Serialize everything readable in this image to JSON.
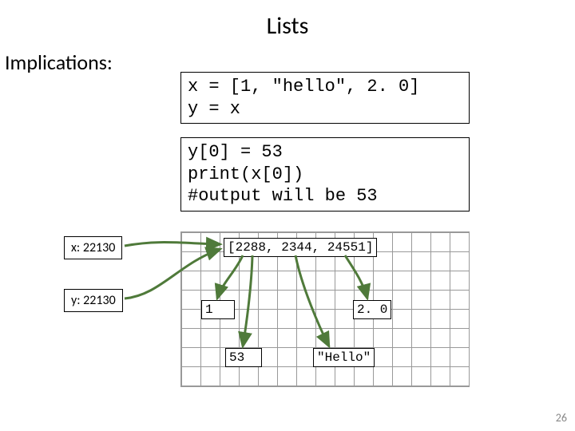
{
  "title": "Lists",
  "subheading": "Implications:",
  "code1": "x = [1, \"hello\", 2. 0]\ny = x",
  "code2": "y[0] = 53\nprint(x[0])\n#output will be 53",
  "vars": {
    "x": "x: 22130",
    "y": "y: 22130"
  },
  "mem": {
    "list": "[2288, 2344, 24551]",
    "v1": "1",
    "v2": "2. 0",
    "v3": "53",
    "v4": "\"Hello\""
  },
  "pagenum": "26"
}
